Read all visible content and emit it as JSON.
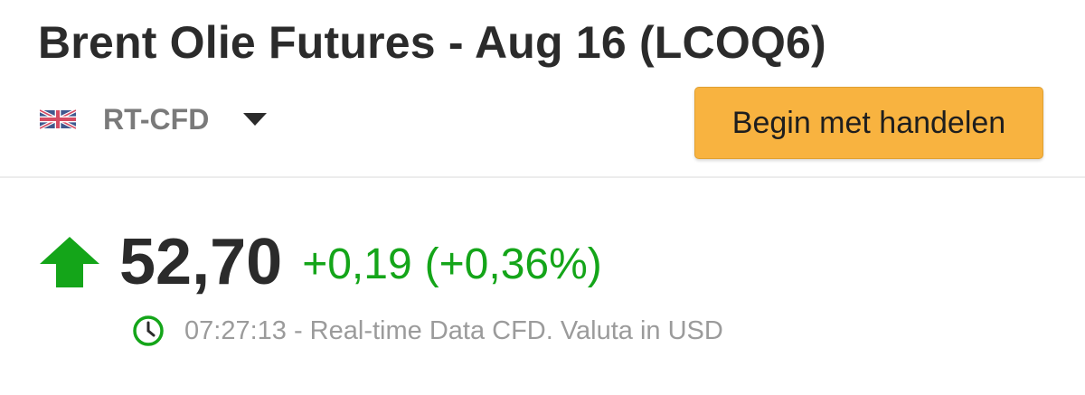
{
  "header": {
    "title": "Brent Olie Futures - Aug 16 (LCOQ6)"
  },
  "exchange": {
    "flag_icon": "uk-flag-icon",
    "label": "RT-CFD",
    "dropdown_icon": "chevron-down-icon"
  },
  "actions": {
    "trade_label": "Begin met handelen",
    "trade_color": "#f8b340"
  },
  "quote": {
    "direction_icon": "arrow-up-icon",
    "last_price": "52,70",
    "change": "+0,19",
    "change_percent": "(+0,36%)",
    "positive_color": "#14a519"
  },
  "meta": {
    "clock_icon": "clock-icon",
    "time": "07:27:13",
    "separator": " - ",
    "description": "Real-time Data CFD. Valuta in USD"
  }
}
